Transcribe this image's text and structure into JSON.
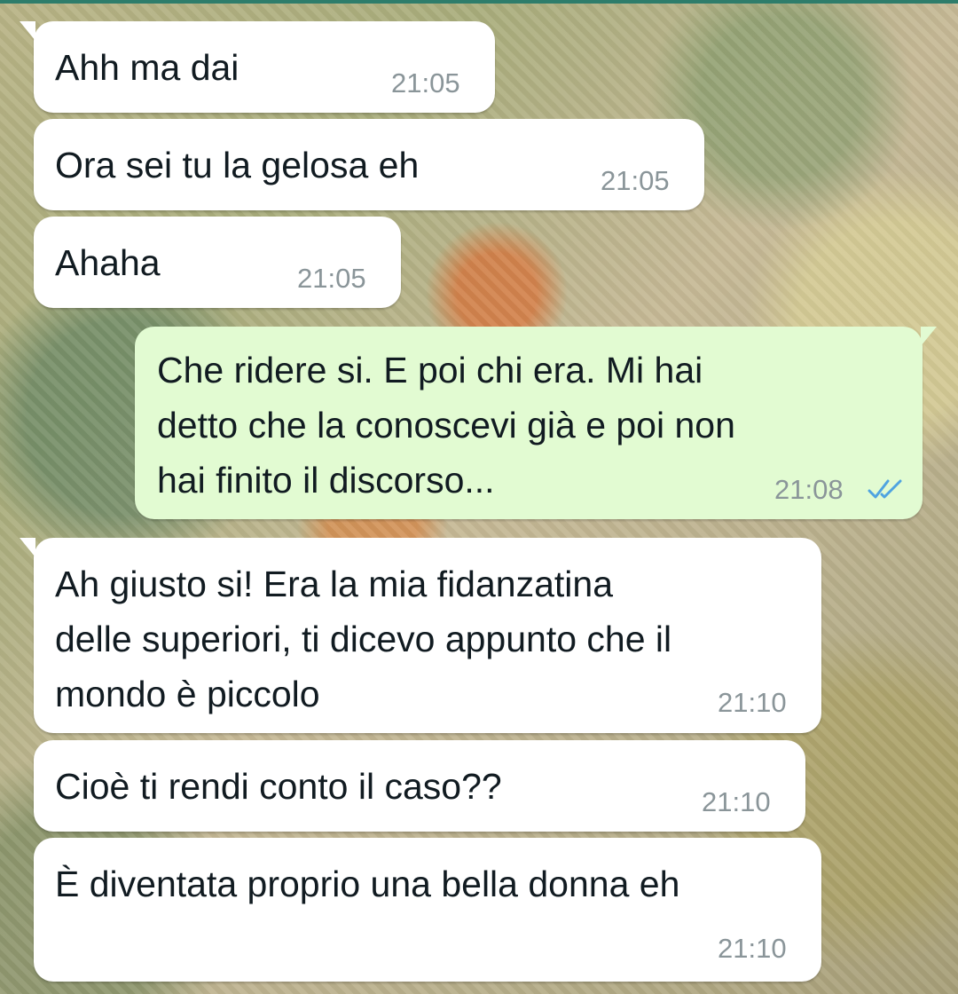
{
  "messages": [
    {
      "direction": "incoming",
      "text": "Ahh ma dai",
      "time": "21:05"
    },
    {
      "direction": "incoming",
      "text": "Ora sei tu la gelosa eh",
      "time": "21:05"
    },
    {
      "direction": "incoming",
      "text": "Ahaha",
      "time": "21:05"
    },
    {
      "direction": "outgoing",
      "text": "Che ridere si. E poi chi era. Mi hai\ndetto che la conoscevi già e poi non\nhai finito il discorso...",
      "time": "21:08",
      "status_icon": "double-check-read-icon"
    },
    {
      "direction": "incoming",
      "text": "Ah giusto si! Era la mia  fidanzatina\ndelle superiori, ti dicevo appunto che il\nmondo è piccolo",
      "time": "21:10"
    },
    {
      "direction": "incoming",
      "text": "Cioè ti rendi conto il caso??",
      "time": "21:10"
    },
    {
      "direction": "incoming",
      "text": "È diventata proprio una bella donna eh",
      "time": "21:10"
    }
  ],
  "colors": {
    "incoming_bubble": "#ffffff",
    "outgoing_bubble": "#e2fbd2",
    "timestamp": "#8a9599",
    "read_ticks": "#4fa3e0"
  }
}
